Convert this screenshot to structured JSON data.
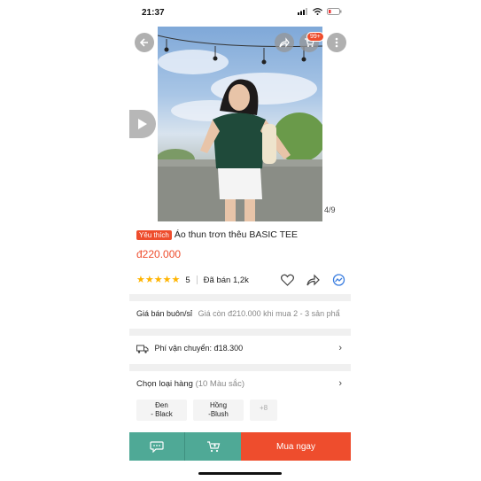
{
  "status": {
    "time": "21:37"
  },
  "gallery": {
    "badge": "99+",
    "counter": "4/9"
  },
  "product": {
    "favorite_tag": "Yêu thích",
    "title": "Áo thun trơn thêu BASIC TEE",
    "price": "đ220.000",
    "rating_value": "5",
    "rating": 5,
    "sold": "Đã bán 1,2k"
  },
  "wholesale": {
    "label": "Giá bán buôn/sỉ",
    "text": "Giá còn đ210.000 khi mua 2 - 3 sản phẩ"
  },
  "shipping": {
    "text": "Phí vận chuyển: đ18.300"
  },
  "variants": {
    "label": "Chọn loại hàng",
    "count": "(10 Màu sắc)",
    "options": [
      {
        "line1": "Đen",
        "line2": "- Black"
      },
      {
        "line1": "Hồng",
        "line2": "-Blush"
      }
    ],
    "more": "+8"
  },
  "bottom": {
    "buy_now": "Mua ngay"
  },
  "colors": {
    "accent": "#ee4d2d",
    "teal": "#4fa996",
    "star": "#ffb400"
  }
}
